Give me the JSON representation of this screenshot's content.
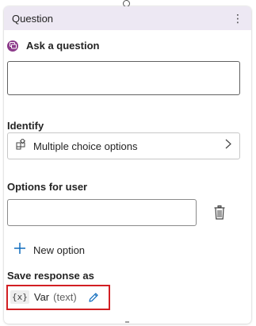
{
  "card": {
    "title": "Question",
    "more_label": "⋮"
  },
  "ask": {
    "label": "Ask a question",
    "value": ""
  },
  "identify": {
    "label": "Identify",
    "value": "Multiple choice options"
  },
  "options": {
    "label": "Options for user",
    "input_value": "",
    "new_option_label": "New option"
  },
  "save_response": {
    "label": "Save response as",
    "var_icon_text": "{x}",
    "var_name": "Var",
    "var_type": "(text)"
  },
  "colors": {
    "header_bg": "#ede8f3",
    "question_icon": "#8c3b8a",
    "edit_icon": "#0f6cbd",
    "highlight": "#d21f23"
  }
}
